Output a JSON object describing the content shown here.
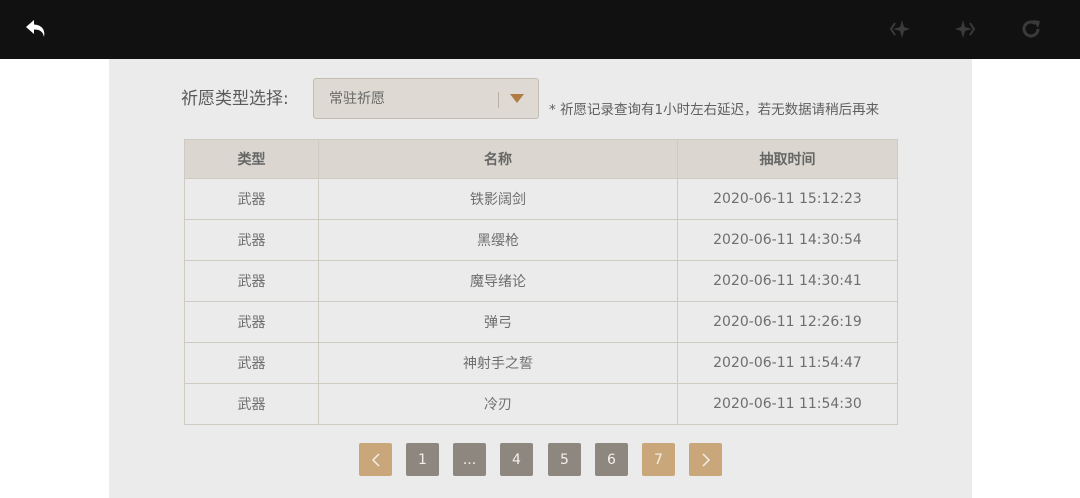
{
  "colors": {
    "topbar": "#111111",
    "panel": "#ebebeb",
    "accent": "#c9a77a",
    "page_button": "#8e8780"
  },
  "topbar": {
    "icons": [
      "back-arrow-icon",
      "prev-star-icon",
      "next-star-icon",
      "refresh-icon"
    ]
  },
  "filter": {
    "label": "祈愿类型选择:",
    "selected": "常驻祈愿",
    "notice": "* 祈愿记录查询有1小时左右延迟，若无数据请稍后再来"
  },
  "table": {
    "headers": [
      "类型",
      "名称",
      "抽取时间"
    ],
    "rows": [
      [
        "武器",
        "铁影阔剑",
        "2020-06-11 15:12:23"
      ],
      [
        "武器",
        "黑缨枪",
        "2020-06-11 14:30:54"
      ],
      [
        "武器",
        "魔导绪论",
        "2020-06-11 14:30:41"
      ],
      [
        "武器",
        "弹弓",
        "2020-06-11 12:26:19"
      ],
      [
        "武器",
        "神射手之誓",
        "2020-06-11 11:54:47"
      ],
      [
        "武器",
        "冷刃",
        "2020-06-11 11:54:30"
      ]
    ]
  },
  "pagination": {
    "prev_icon": "chevron-left-icon",
    "next_icon": "chevron-right-icon",
    "pages": [
      "1",
      "...",
      "4",
      "5",
      "6",
      "7"
    ],
    "current": "7"
  }
}
